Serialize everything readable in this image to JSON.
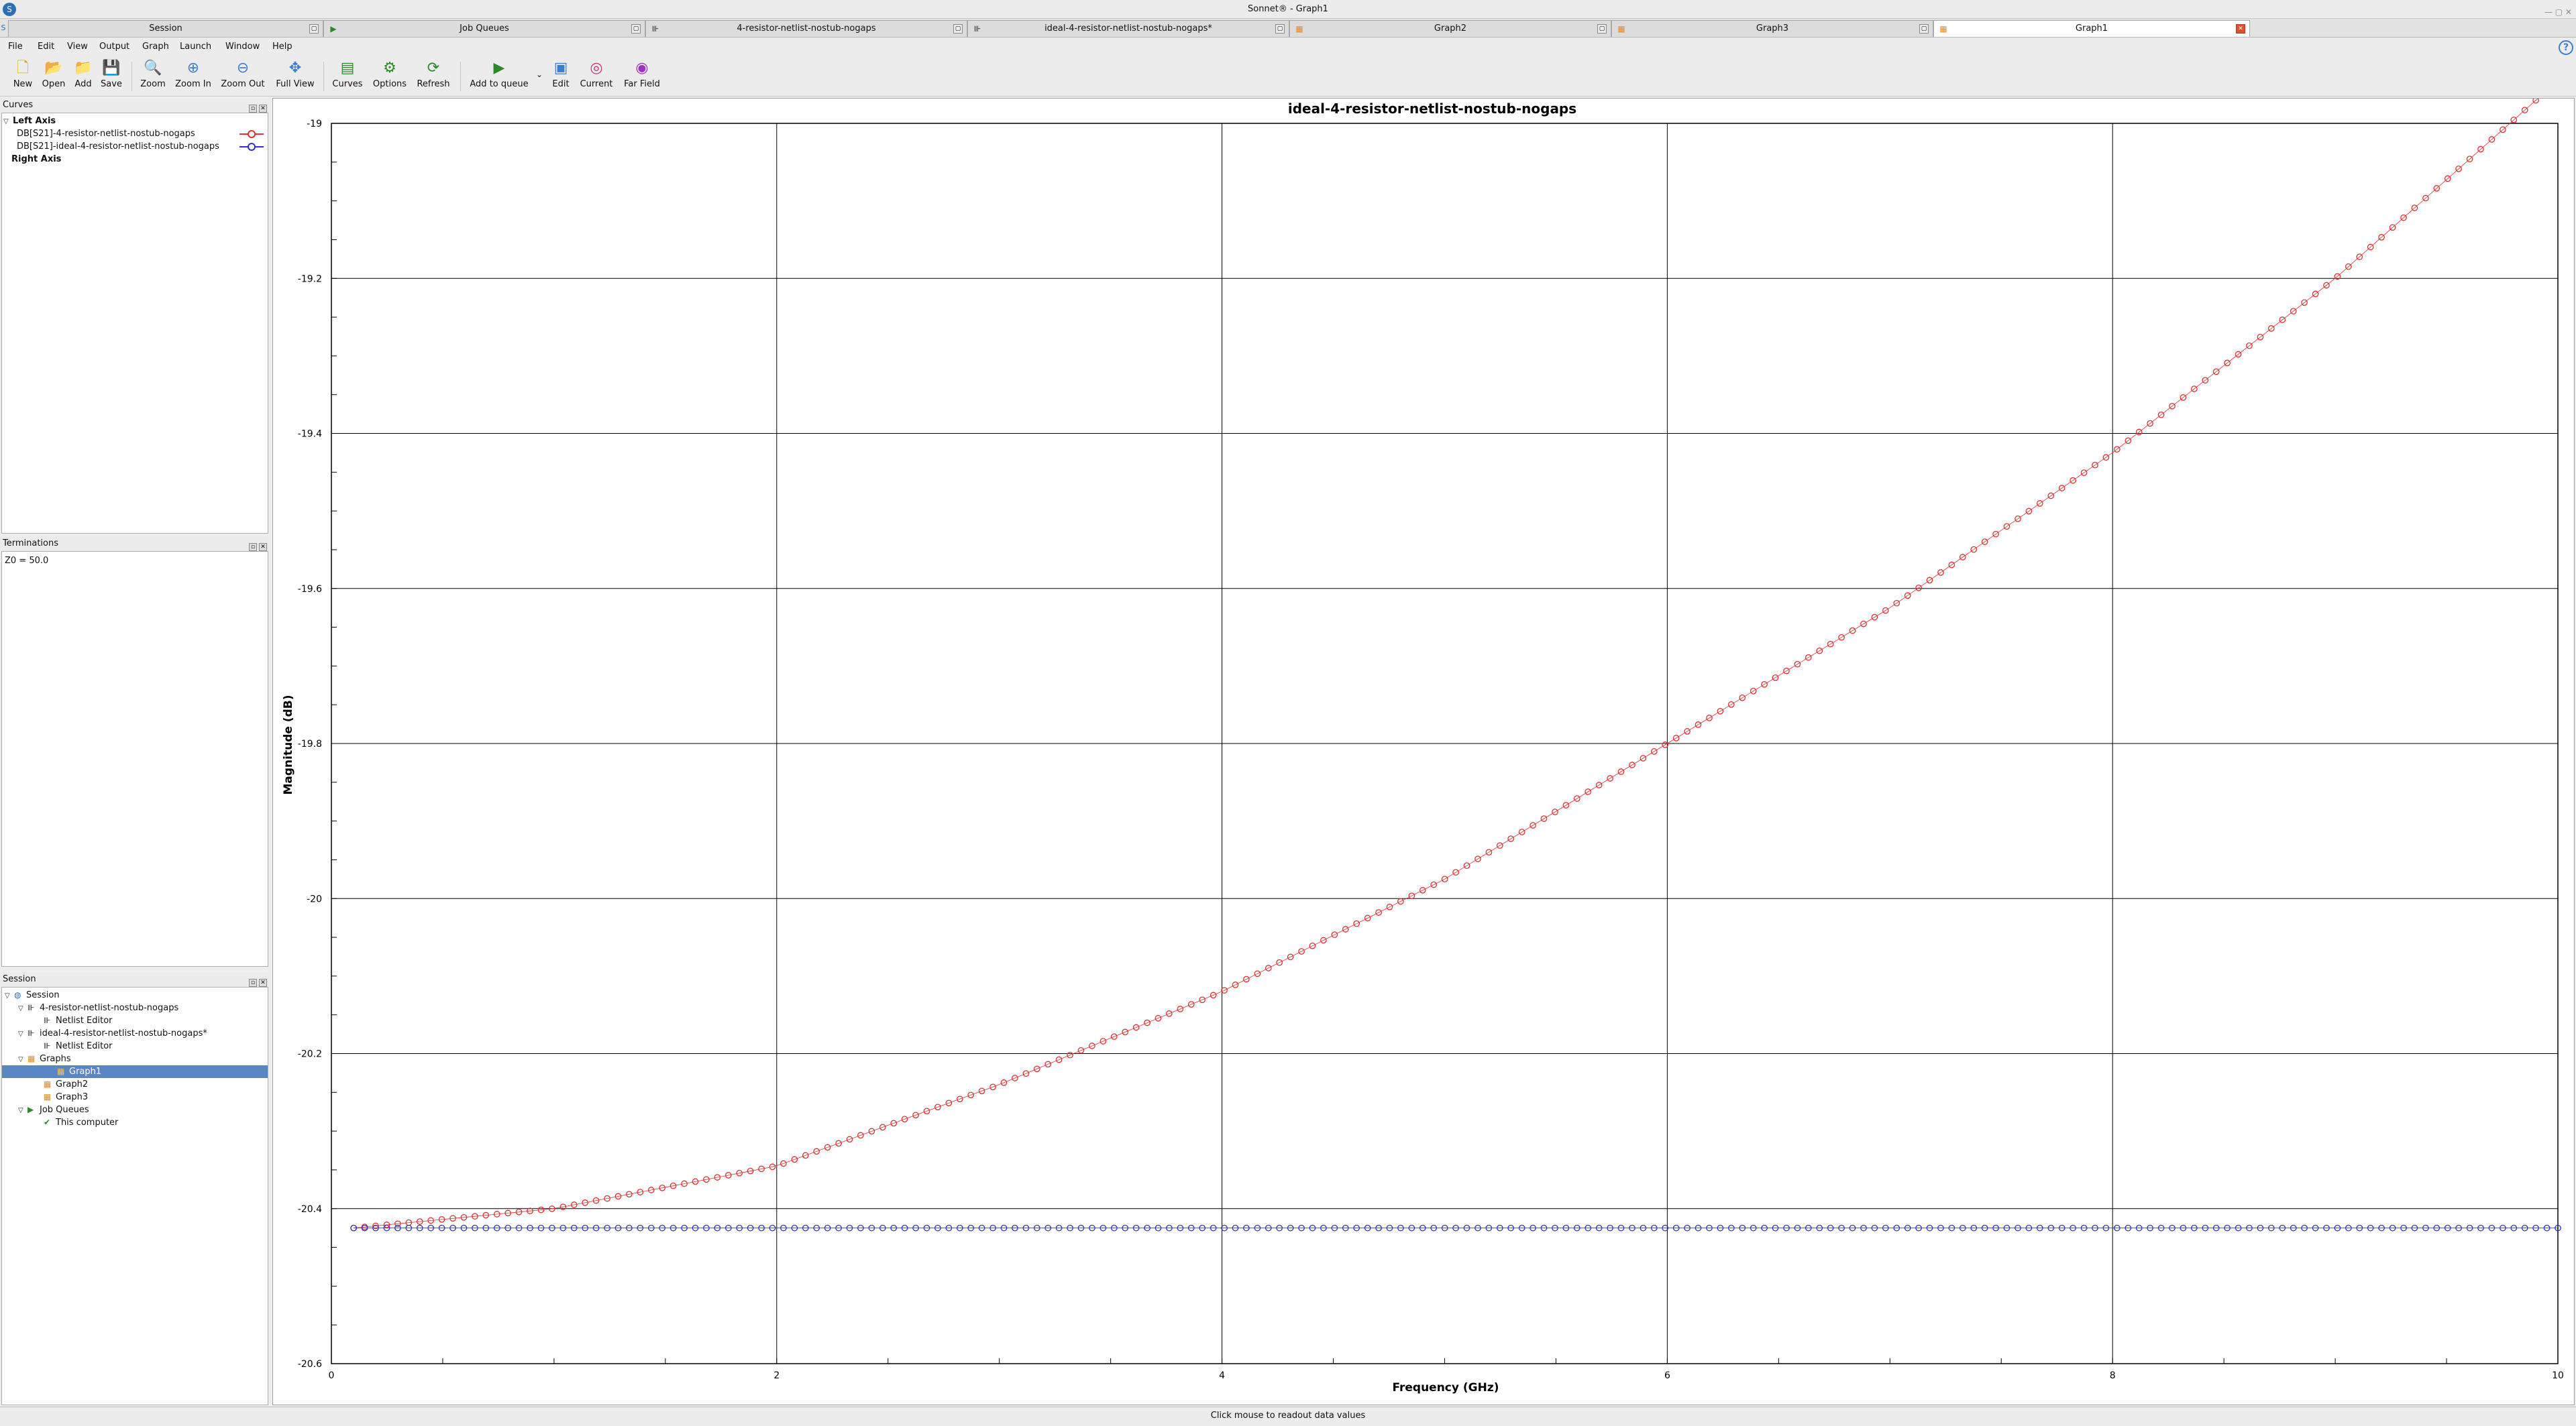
{
  "window": {
    "title": "Sonnet® - Graph1"
  },
  "tabs": [
    {
      "label": "Session",
      "active": false
    },
    {
      "label": "Job Queues",
      "active": false
    },
    {
      "label": "4-resistor-netlist-nostub-nogaps",
      "active": false
    },
    {
      "label": "ideal-4-resistor-netlist-nostub-nogaps*",
      "active": false
    },
    {
      "label": "Graph2",
      "active": false
    },
    {
      "label": "Graph3",
      "active": false
    },
    {
      "label": "Graph1",
      "active": true
    }
  ],
  "menu": [
    "File",
    "Edit",
    "View",
    "Output",
    "Graph",
    "Launch",
    "Window",
    "Help"
  ],
  "toolbar": {
    "new": "New",
    "open": "Open",
    "add": "Add",
    "save": "Save",
    "zoom": "Zoom",
    "zoom_in": "Zoom In",
    "zoom_out": "Zoom Out",
    "full_view": "Full View",
    "curves": "Curves",
    "options": "Options",
    "refresh": "Refresh",
    "add_to_queue": "Add to queue",
    "edit": "Edit",
    "current": "Current",
    "far_field": "Far Field"
  },
  "curves_panel": {
    "title": "Curves",
    "left_axis": "Left Axis",
    "right_axis": "Right Axis",
    "curves": [
      {
        "label": "DB[S21]-4-resistor-netlist-nostub-nogaps",
        "color": "#e03030"
      },
      {
        "label": "DB[S21]-ideal-4-resistor-netlist-nostub-nogaps",
        "color": "#3030d0"
      }
    ]
  },
  "terminations_panel": {
    "title": "Terminations",
    "text": "Z0 = 50.0"
  },
  "session_panel": {
    "title": "Session",
    "root": "Session",
    "project1": "4-resistor-netlist-nostub-nogaps",
    "project1_editor": "Netlist Editor",
    "project2": "ideal-4-resistor-netlist-nostub-nogaps*",
    "project2_editor": "Netlist Editor",
    "graphs": "Graphs",
    "graph1": "Graph1",
    "graph2": "Graph2",
    "graph3": "Graph3",
    "job_queues": "Job Queues",
    "this_computer": "This computer"
  },
  "status": {
    "text": "Click mouse to readout data values"
  },
  "chart_data": {
    "type": "line",
    "title": "ideal-4-resistor-netlist-nostub-nogaps",
    "xlabel": "Frequency (GHz)",
    "ylabel": "Magnitude (dB)",
    "xlim": [
      0,
      10
    ],
    "ylim": [
      -20.6,
      -19
    ],
    "xticks": [
      0,
      2,
      4,
      6,
      8,
      10
    ],
    "yticks": [
      -19,
      -19.2,
      -19.4,
      -19.6,
      -19.8,
      -20,
      -20.2,
      -20.4,
      -20.6
    ],
    "grid": true,
    "series": [
      {
        "name": "DB[S21]-4-resistor-netlist-nostub-nogaps",
        "color": "#e03030",
        "x": [
          0.1,
          1,
          2,
          3,
          4,
          5,
          6,
          7,
          8,
          9,
          10
        ],
        "y": [
          -20.425,
          -20.4,
          -20.345,
          -20.24,
          -20.12,
          -19.975,
          -19.8,
          -19.625,
          -19.425,
          -19.2,
          -18.945
        ]
      },
      {
        "name": "DB[S21]-ideal-4-resistor-netlist-nostub-nogaps",
        "color": "#3030d0",
        "x": [
          0.1,
          10
        ],
        "y": [
          -20.425,
          -20.425
        ]
      }
    ]
  }
}
